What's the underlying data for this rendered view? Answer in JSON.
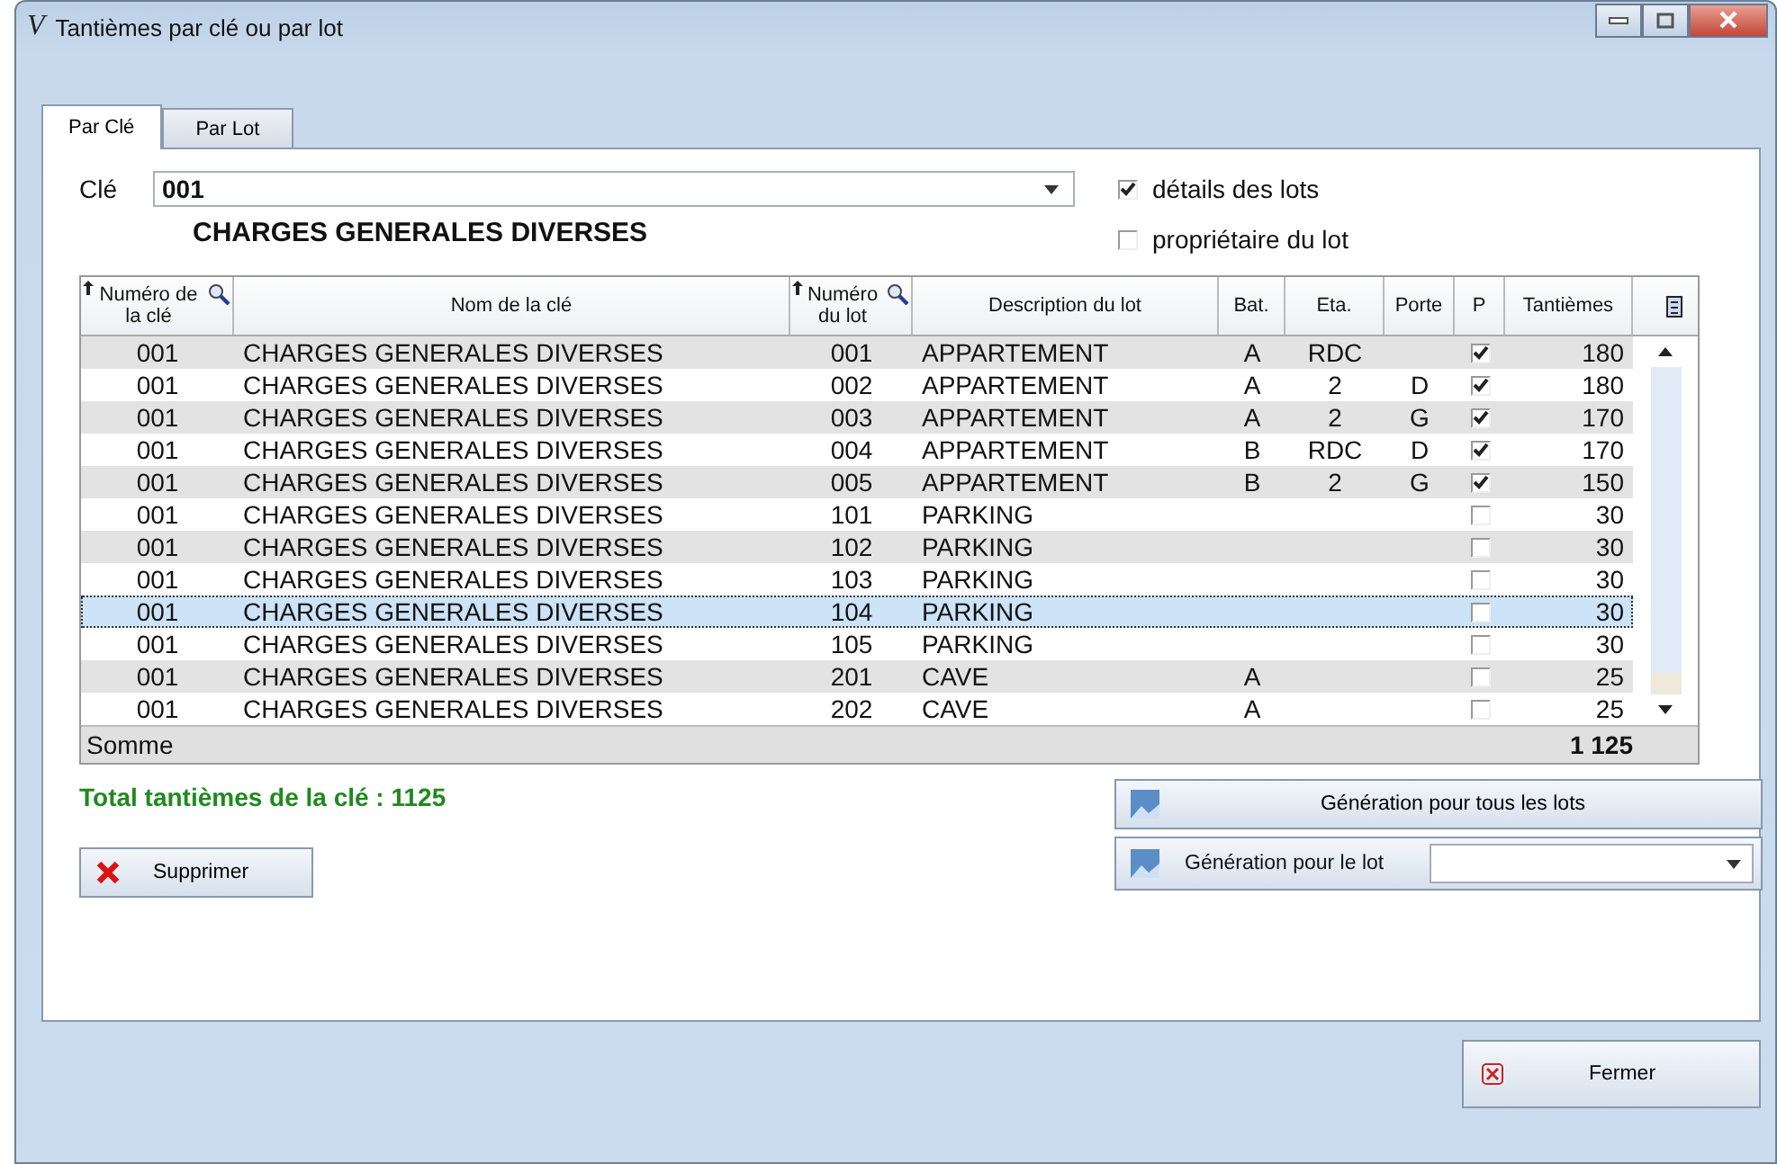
{
  "window": {
    "title": "Tantièmes par clé ou par lot",
    "icon_letter": "V"
  },
  "tabs": [
    {
      "label": "Par Clé",
      "selected": true
    },
    {
      "label": "Par Lot",
      "selected": false
    }
  ],
  "key_field": {
    "label": "Clé",
    "value": "001"
  },
  "key_name": "CHARGES GENERALES DIVERSES",
  "options": [
    {
      "label": "détails des lots",
      "checked": true
    },
    {
      "label": "propriétaire du lot",
      "checked": false
    }
  ],
  "table": {
    "columns": [
      {
        "label": "Numéro de la clé",
        "sortable": true
      },
      {
        "label": "Nom de la clé",
        "sortable": false
      },
      {
        "label": "Numéro du lot",
        "sortable": true
      },
      {
        "label": "Description du lot",
        "sortable": false
      },
      {
        "label": "Bat.",
        "sortable": false
      },
      {
        "label": "Eta.",
        "sortable": false
      },
      {
        "label": "Porte",
        "sortable": false
      },
      {
        "label": "P",
        "sortable": false
      },
      {
        "label": "Tantièmes",
        "sortable": false
      }
    ],
    "rows": [
      {
        "cells": [
          "001",
          "CHARGES GENERALES DIVERSES",
          "001",
          "APPARTEMENT",
          "A",
          "RDC",
          ""
        ],
        "p_checked": true,
        "tantiemes": "180",
        "selected": false
      },
      {
        "cells": [
          "001",
          "CHARGES GENERALES DIVERSES",
          "002",
          "APPARTEMENT",
          "A",
          "2",
          "D"
        ],
        "p_checked": true,
        "tantiemes": "180",
        "selected": false
      },
      {
        "cells": [
          "001",
          "CHARGES GENERALES DIVERSES",
          "003",
          "APPARTEMENT",
          "A",
          "2",
          "G"
        ],
        "p_checked": true,
        "tantiemes": "170",
        "selected": false
      },
      {
        "cells": [
          "001",
          "CHARGES GENERALES DIVERSES",
          "004",
          "APPARTEMENT",
          "B",
          "RDC",
          "D"
        ],
        "p_checked": true,
        "tantiemes": "170",
        "selected": false
      },
      {
        "cells": [
          "001",
          "CHARGES GENERALES DIVERSES",
          "005",
          "APPARTEMENT",
          "B",
          "2",
          "G"
        ],
        "p_checked": true,
        "tantiemes": "150",
        "selected": false
      },
      {
        "cells": [
          "001",
          "CHARGES GENERALES DIVERSES",
          "101",
          "PARKING",
          "",
          "",
          ""
        ],
        "p_checked": false,
        "tantiemes": "30",
        "selected": false
      },
      {
        "cells": [
          "001",
          "CHARGES GENERALES DIVERSES",
          "102",
          "PARKING",
          "",
          "",
          ""
        ],
        "p_checked": false,
        "tantiemes": "30",
        "selected": false
      },
      {
        "cells": [
          "001",
          "CHARGES GENERALES DIVERSES",
          "103",
          "PARKING",
          "",
          "",
          ""
        ],
        "p_checked": false,
        "tantiemes": "30",
        "selected": false
      },
      {
        "cells": [
          "001",
          "CHARGES GENERALES DIVERSES",
          "104",
          "PARKING",
          "",
          "",
          ""
        ],
        "p_checked": false,
        "tantiemes": "30",
        "selected": true
      },
      {
        "cells": [
          "001",
          "CHARGES GENERALES DIVERSES",
          "105",
          "PARKING",
          "",
          "",
          ""
        ],
        "p_checked": false,
        "tantiemes": "30",
        "selected": false
      },
      {
        "cells": [
          "001",
          "CHARGES GENERALES DIVERSES",
          "201",
          "CAVE",
          "A",
          "",
          ""
        ],
        "p_checked": false,
        "tantiemes": "25",
        "selected": false
      },
      {
        "cells": [
          "001",
          "CHARGES GENERALES DIVERSES",
          "202",
          "CAVE",
          "A",
          "",
          ""
        ],
        "p_checked": false,
        "tantiemes": "25",
        "selected": false
      }
    ],
    "sum_label": "Somme",
    "sum_value": "1 125"
  },
  "total_text": "Total tantièmes de la clé : 1125",
  "buttons": {
    "delete": "Supprimer",
    "generate_all": "Génération pour tous les lots",
    "generate_lot": "Génération pour le lot",
    "close": "Fermer"
  }
}
